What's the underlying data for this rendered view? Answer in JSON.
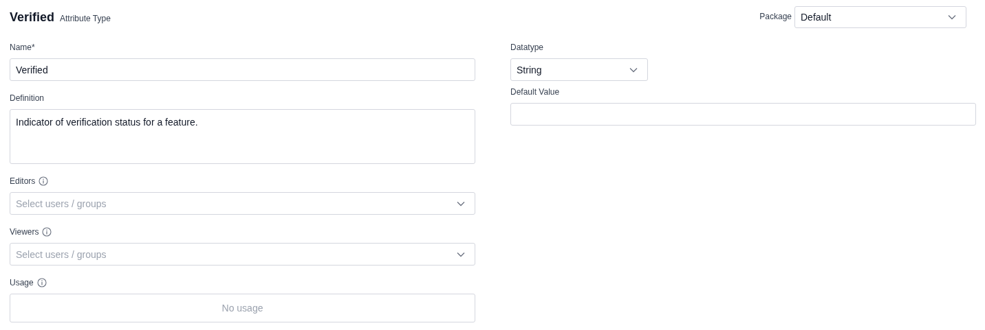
{
  "header": {
    "title": "Verified",
    "subtitle": "Attribute Type",
    "package": {
      "label": "Package",
      "value": "Default"
    }
  },
  "left_fields": [
    {
      "kind": "text",
      "label": "Name*",
      "value": "Verified"
    },
    {
      "kind": "textarea",
      "label": "Definition",
      "value": "Indicator of verification status for a feature."
    },
    {
      "kind": "multiselect",
      "label": "Editors",
      "info": true,
      "placeholder": "Select users / groups"
    },
    {
      "kind": "multiselect",
      "label": "Viewers",
      "info": true,
      "placeholder": "Select users / groups"
    },
    {
      "kind": "usage",
      "label": "Usage",
      "info": true,
      "value": "No usage"
    }
  ],
  "right_fields": [
    {
      "kind": "select",
      "label": "Datatype",
      "value": "String"
    },
    {
      "kind": "text",
      "label": "Default Value"
    }
  ]
}
